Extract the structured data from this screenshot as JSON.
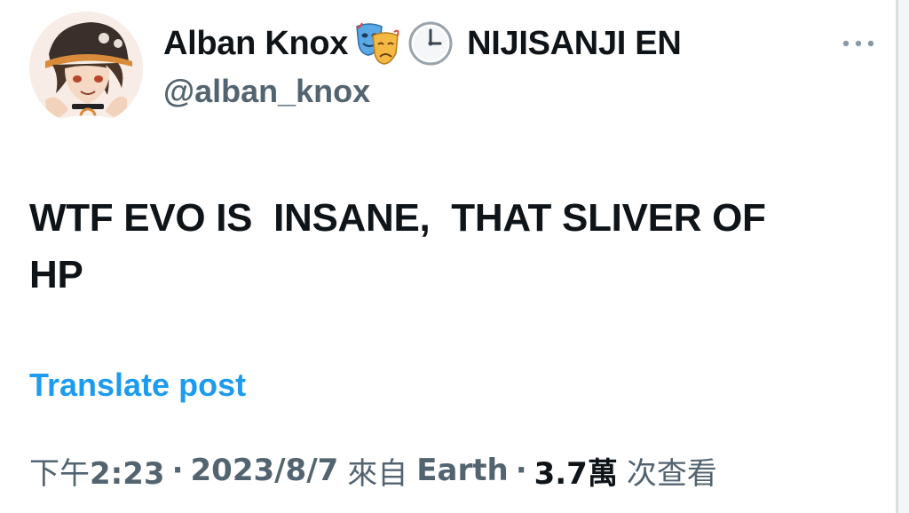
{
  "tweet": {
    "author": {
      "display_name": "Alban Knox",
      "emojis": [
        "performing-arts-icon",
        "clock-icon"
      ],
      "affiliation": "NIJISANJI EN",
      "handle": "@alban_knox",
      "avatar": "avatar-icon"
    },
    "more_icon": "more-horizontal-icon",
    "text": "WTF EVO IS  INSANE,  THAT SLIVER OF\nHP",
    "translate_label": "Translate post",
    "meta": {
      "time_prefix": "下午",
      "time": "2:23",
      "separator": "·",
      "date": "2023/8/7",
      "source_prefix": "來自",
      "source": "Earth",
      "views_count": "3.7萬",
      "views_label": "次查看"
    }
  },
  "colors": {
    "text_primary": "#0f1419",
    "text_secondary": "#536471",
    "link": "#1d9bf0",
    "background": "#ffffff"
  }
}
